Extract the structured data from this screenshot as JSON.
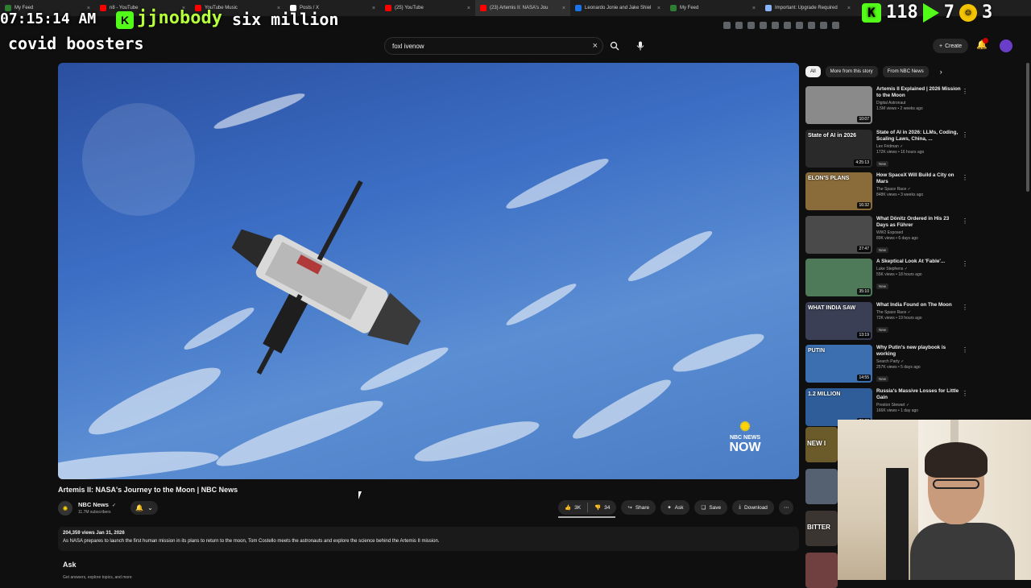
{
  "browser": {
    "tabs": [
      {
        "label": "My Feed",
        "favicon_color": "#2e7d32",
        "active": false
      },
      {
        "label": "n8 - YouTube",
        "favicon_color": "#ff0000",
        "active": false
      },
      {
        "label": "YouTube Music",
        "favicon_color": "#ff0000",
        "active": false
      },
      {
        "label": "Posts / X",
        "favicon_color": "#ffffff",
        "active": false
      },
      {
        "label": "(25) YouTube",
        "favicon_color": "#ff0000",
        "active": false
      },
      {
        "label": "(23) Artemis II: NASA's Jou",
        "favicon_color": "#ff0000",
        "active": true
      },
      {
        "label": "Leonardo Jonie and Jake Shiel",
        "favicon_color": "#1a73e8",
        "active": false
      },
      {
        "label": "My Feed",
        "favicon_color": "#2e7d32",
        "active": false
      },
      {
        "label": "Important: Upgrade Required",
        "favicon_color": "#8ab4f8",
        "active": false
      }
    ]
  },
  "overlay": {
    "time": "07:15:14 AM",
    "username": "jjnobody",
    "kick_badge": "K",
    "phrase": "six million",
    "boosters": "covid boosters",
    "stat_1": "118",
    "stat_2": "7",
    "stat_3": "3"
  },
  "header": {
    "search_value": "foxl ivenow",
    "clear_icon": "×",
    "create_label": "Create",
    "accent_color": "#ff0000"
  },
  "video": {
    "watermark_line1": "NBC NEWS",
    "watermark_line2": "NOW",
    "title": "Artemis II: NASA's Journey to the Moon | NBC News",
    "channel_name": "NBC News",
    "channel_verified": "✓",
    "subscribers": "11.7M subscribers",
    "likes": "3K",
    "dislikes": "34",
    "share_label": "Share",
    "ask_label": "Ask",
    "save_label": "Save",
    "download_label": "Download",
    "views_date": "204,359 views  Jan 31, 2026",
    "description": "As NASA prepares to launch the first human mission in its plans to return to the moon, Tom Costello meets the astronauts and explore the science behind the Artemis II mission.",
    "ask_section_title": "Ask",
    "ask_section_sub": "Get answers, explore topics, and more"
  },
  "sidebar": {
    "chips": [
      {
        "label": "All",
        "active": true
      },
      {
        "label": "More from this story",
        "active": false
      },
      {
        "label": "From NBC News",
        "active": false
      }
    ],
    "recommendations": [
      {
        "title": "Artemis II Explained | 2026 Mission to the Moon",
        "channel": "Digital Astronaut",
        "meta": "1.5M views • 2 weeks ago",
        "duration": "10:07",
        "badge": "",
        "thumb_text": "",
        "thumb_color": "#8a8a8a"
      },
      {
        "title": "State of AI in 2026: LLMs, Coding, Scaling Laws, China, ...",
        "channel": "Lex Fridman ✓",
        "meta": "172K views • 16 hours ago",
        "duration": "4:25:13",
        "badge": "New",
        "thumb_text": "State of AI in 2026",
        "thumb_color": "#2a2a2a"
      },
      {
        "title": "How SpaceX Will Build a City on Mars",
        "channel": "The Space Race ✓",
        "meta": "848K views • 3 weeks ago",
        "duration": "16:32",
        "badge": "",
        "thumb_text": "ELON'S PLANS",
        "thumb_color": "#8a6b3a"
      },
      {
        "title": "What Dönitz Ordered in His 23 Days as Führer",
        "channel": "WW2 Exposed",
        "meta": "89K views • 6 days ago",
        "duration": "27:47",
        "badge": "New",
        "thumb_text": "",
        "thumb_color": "#4a4a4a"
      },
      {
        "title": "A Skeptical Look At 'Fable'...",
        "channel": "Luke Stephens ✓",
        "meta": "55K views • 18 hours ago",
        "duration": "35:10",
        "badge": "New",
        "thumb_text": "",
        "thumb_color": "#4f7a5a"
      },
      {
        "title": "What India Found on The Moon",
        "channel": "The Space Race ✓",
        "meta": "72K views • 19 hours ago",
        "duration": "13:19",
        "badge": "New",
        "thumb_text": "WHAT INDIA SAW",
        "thumb_color": "#3a3f55"
      },
      {
        "title": "Why Putin's new playbook is working",
        "channel": "Search Party ✓",
        "meta": "257K views • 5 days ago",
        "duration": "14:55",
        "badge": "New",
        "thumb_text": "PUTIN",
        "thumb_color": "#3b6fb0"
      },
      {
        "title": "Russia's Massive Losses for Little Gain",
        "channel": "Preston Stewart ✓",
        "meta": "166K views • 1 day ago",
        "duration": "23:00",
        "badge": "New",
        "thumb_text": "1.2 MILLION",
        "thumb_color": "#2f5d9a"
      }
    ],
    "peek_items": [
      {
        "text": "NEW I",
        "color": "#6b5a2a"
      },
      {
        "text": "",
        "color": "#556070"
      },
      {
        "text": "BITTER",
        "color": "#3a3530"
      },
      {
        "text": "",
        "color": "#704040"
      }
    ]
  }
}
